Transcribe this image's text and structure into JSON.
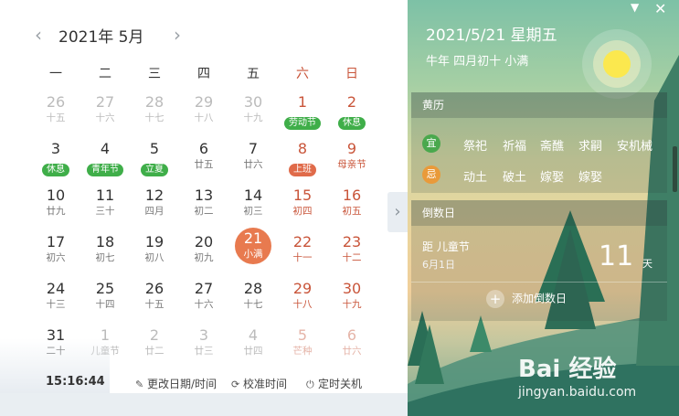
{
  "header": {
    "month_title": "2021年 5月",
    "prev_icon": "chevron-left",
    "next_icon": "chevron-right"
  },
  "weekdays": [
    "一",
    "二",
    "三",
    "四",
    "五",
    "六",
    "日"
  ],
  "weeks": [
    [
      {
        "d": "26",
        "s": "十五",
        "dim": true
      },
      {
        "d": "27",
        "s": "十六",
        "dim": true
      },
      {
        "d": "28",
        "s": "十七",
        "dim": true
      },
      {
        "d": "29",
        "s": "十八",
        "dim": true
      },
      {
        "d": "30",
        "s": "十九",
        "dim": true
      },
      {
        "d": "1",
        "s": "劳动节",
        "pill": "green"
      },
      {
        "d": "2",
        "s": "休息",
        "pill": "green"
      }
    ],
    [
      {
        "d": "3",
        "s": "休息",
        "pill": "green"
      },
      {
        "d": "4",
        "s": "青年节",
        "pill": "green"
      },
      {
        "d": "5",
        "s": "立夏",
        "pill": "green"
      },
      {
        "d": "6",
        "s": "廿五"
      },
      {
        "d": "7",
        "s": "廿六"
      },
      {
        "d": "8",
        "s": "上班",
        "pill": "red"
      },
      {
        "d": "9",
        "s": "母亲节"
      }
    ],
    [
      {
        "d": "10",
        "s": "廿九"
      },
      {
        "d": "11",
        "s": "三十"
      },
      {
        "d": "12",
        "s": "四月"
      },
      {
        "d": "13",
        "s": "初二"
      },
      {
        "d": "14",
        "s": "初三"
      },
      {
        "d": "15",
        "s": "初四"
      },
      {
        "d": "16",
        "s": "初五"
      }
    ],
    [
      {
        "d": "17",
        "s": "初六"
      },
      {
        "d": "18",
        "s": "初七"
      },
      {
        "d": "19",
        "s": "初八"
      },
      {
        "d": "20",
        "s": "初九"
      },
      {
        "d": "21",
        "s": "小满",
        "sel": true
      },
      {
        "d": "22",
        "s": "十一"
      },
      {
        "d": "23",
        "s": "十二"
      }
    ],
    [
      {
        "d": "24",
        "s": "十三"
      },
      {
        "d": "25",
        "s": "十四"
      },
      {
        "d": "26",
        "s": "十五"
      },
      {
        "d": "27",
        "s": "十六"
      },
      {
        "d": "28",
        "s": "十七"
      },
      {
        "d": "29",
        "s": "十八"
      },
      {
        "d": "30",
        "s": "十九"
      }
    ],
    [
      {
        "d": "31",
        "s": "二十"
      },
      {
        "d": "1",
        "s": "儿童节",
        "dim": true
      },
      {
        "d": "2",
        "s": "廿二",
        "dim": true
      },
      {
        "d": "3",
        "s": "廿三",
        "dim": true
      },
      {
        "d": "4",
        "s": "廿四",
        "dim": true
      },
      {
        "d": "5",
        "s": "芒种",
        "dim": true
      },
      {
        "d": "6",
        "s": "廿六",
        "dim": true
      }
    ]
  ],
  "footer": {
    "clock": "15:16:44",
    "change_datetime": "更改日期/时间",
    "sync_time": "校准时间",
    "shutdown": "定时关机"
  },
  "panel": {
    "date_line": "2021/5/21  星期五",
    "lunar_line": "牛年 四月初十  小满",
    "almanac_title": "黄历",
    "yi_label": "宜",
    "yi_items": [
      "祭祀",
      "祈福",
      "斋醮",
      "求嗣",
      "安机械"
    ],
    "ji_label": "忌",
    "ji_items": [
      "动土",
      "破土",
      "嫁娶",
      "嫁娶"
    ],
    "countdown_title": "倒数日",
    "countdown_name": "距 儿童节",
    "countdown_date": "6月1日",
    "countdown_days": "11",
    "countdown_unit": "天",
    "add_countdown": "添加倒数日"
  },
  "watermark": {
    "logo": "Bai 经验",
    "site": "jingyan.baidu.com"
  },
  "colors": {
    "weekend": "#c9553a",
    "holiday_pill": "#3fae49",
    "workday_pill": "#e06b4a",
    "selected": "#e87a4f",
    "yi": "#4aa84d",
    "ji": "#e99a3a"
  }
}
